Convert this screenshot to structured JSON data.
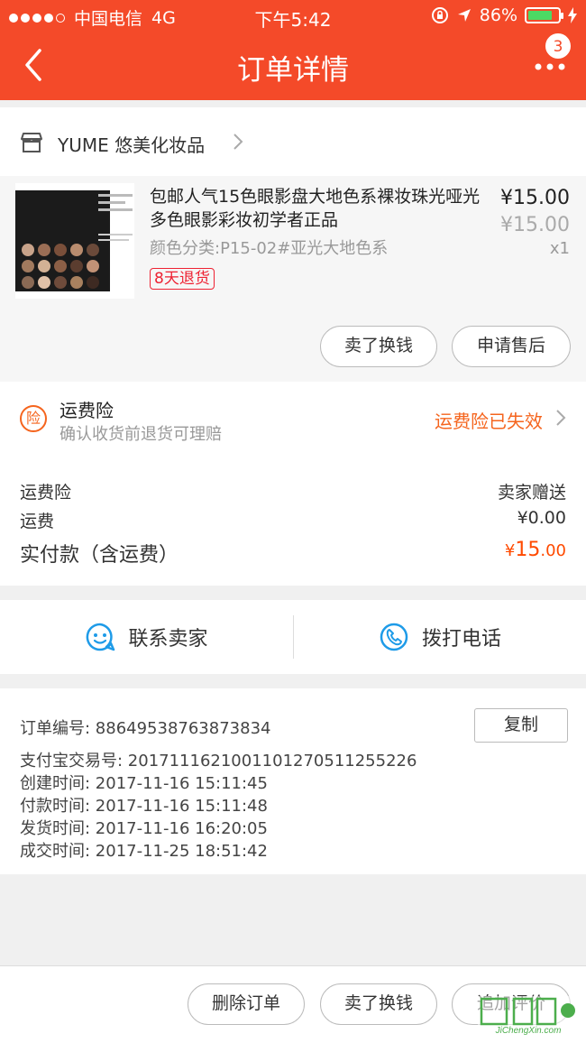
{
  "status_bar": {
    "carrier": "中国电信",
    "network": "4G",
    "time": "下午5:42",
    "battery": "86%"
  },
  "nav": {
    "title": "订单详情",
    "badge_count": "3"
  },
  "shop": {
    "name": "YUME 悠美化妆品"
  },
  "product": {
    "title": "包邮人气15色眼影盘大地色系裸妆珠光哑光多色眼影彩妆初学者正品",
    "attribute": "颜色分类:P15-02#亚光大地色系",
    "tag": "8天退货",
    "price": "¥15.00",
    "original_price": "¥15.00",
    "quantity": "x1",
    "actions": [
      "卖了换钱",
      "申请售后"
    ]
  },
  "insurance": {
    "badge": "险",
    "title": "运费险",
    "subtitle": "确认收货前退货可理赔",
    "status": "运费险已失效"
  },
  "costs": {
    "rows": [
      {
        "label": "运费险",
        "value": "卖家赠送"
      },
      {
        "label": "运费",
        "value": "¥0.00"
      }
    ],
    "total_label": "实付款（含运费）",
    "total_currency": "¥",
    "total_int": "15",
    "total_dec": ".00"
  },
  "contact": {
    "seller": "联系卖家",
    "phone": "拨打电话"
  },
  "order_info": {
    "copy_label": "复制",
    "lines": [
      "订单编号:   88649538763873834",
      "支付宝交易号:   2017111621001101270511255226",
      "创建时间:   2017-11-16 15:11:45",
      "付款时间:   2017-11-16 15:11:48",
      "发货时间:   2017-11-16 16:20:05",
      "成交时间:   2017-11-25 18:51:42"
    ]
  },
  "bottom_actions": [
    "删除订单",
    "卖了换钱",
    "追加评价"
  ],
  "watermark": {
    "text": "JiChengXin.com"
  },
  "colors": {
    "brand": "#f44a29",
    "orange": "#f5641d",
    "price_red": "#ff4a00",
    "tag_red": "#e23"
  }
}
